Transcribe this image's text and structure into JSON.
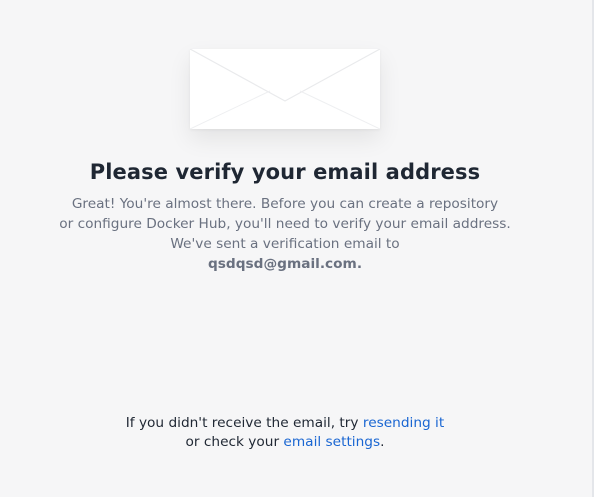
{
  "title": "Please verify your email address",
  "message": {
    "line1": "Great! You're almost there. Before you can create a repository",
    "line2": "or configure Docker Hub, you'll need to verify your email address.",
    "line3": "We've sent a verification email to",
    "email": "qsdqsd@gmail.com."
  },
  "footer": {
    "prefix": "If you didn't receive the email, try ",
    "resend_link": "resending it",
    "middle": "or check your ",
    "settings_link": "email settings",
    "suffix": "."
  },
  "icons": {
    "envelope": "envelope-icon"
  },
  "colors": {
    "background": "#f6f6f7",
    "title": "#1f2733",
    "body_text": "#6a7180",
    "link": "#1a66d2"
  }
}
